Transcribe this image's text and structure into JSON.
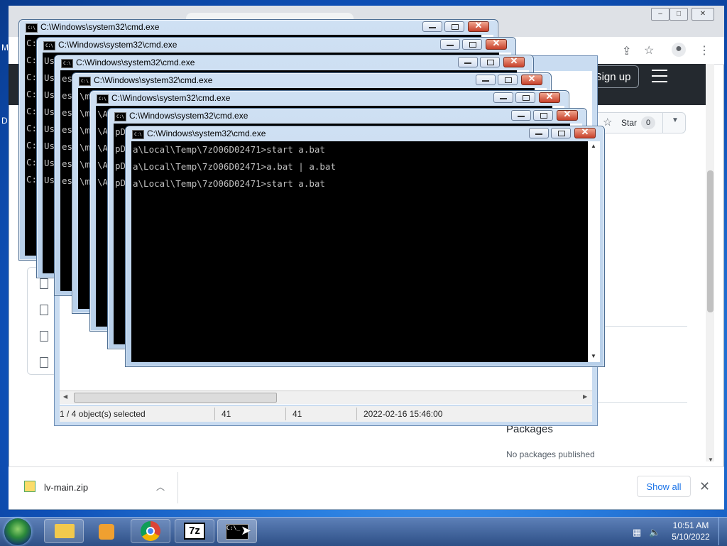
{
  "desktop": {
    "letters": [
      "M",
      "D"
    ]
  },
  "chrome": {
    "signup_label": "Sign up",
    "star_label": "Star",
    "star_count": "0",
    "packages_title": "Packages",
    "packages_subtitle": "No packages published"
  },
  "download_bar": {
    "file_name": "lv-main.zip",
    "show_all_label": "Show all"
  },
  "sevenzip": {
    "status_selected": "1 / 4 object(s) selected",
    "status_size": "41",
    "status_packed": "41",
    "status_modified": "2022-02-16 15:46:00"
  },
  "cmd_windows": {
    "title": "C:\\Windows\\system32\\cmd.exe",
    "front_lines": [
      "a\\Local\\Temp\\7zO06D02471>start a.bat",
      "a\\Local\\Temp\\7zO06D02471>a.bat | a.bat",
      "a\\Local\\Temp\\7zO06D02471>start a.bat"
    ],
    "back_prefixes": [
      "C:",
      "C:",
      "C:",
      "C:",
      "C:",
      "C:",
      "C:",
      "C:",
      "C:"
    ],
    "col2": [
      "Us",
      "Us",
      "Us",
      "Us",
      "Us",
      "Us",
      "Us",
      "Us"
    ],
    "col3": [
      "es",
      "es",
      "es",
      "es",
      "es",
      "es",
      "es"
    ],
    "col4": [
      "\\mi",
      "\\mi",
      "\\mi",
      "\\mi",
      "\\mi",
      "\\mi"
    ],
    "col5": [
      "\\Ap",
      "\\Ap",
      "\\Ap",
      "\\Ap",
      "\\Ap"
    ],
    "col6": [
      "pDa",
      "pDa",
      "pDa",
      "pDa"
    ],
    "right_fragments": [
      "ca",
      "mp",
      "\""
    ]
  },
  "taskbar": {
    "clock_time": "10:51 AM",
    "clock_date": "5/10/2022",
    "sevenzip_label": "7z"
  }
}
